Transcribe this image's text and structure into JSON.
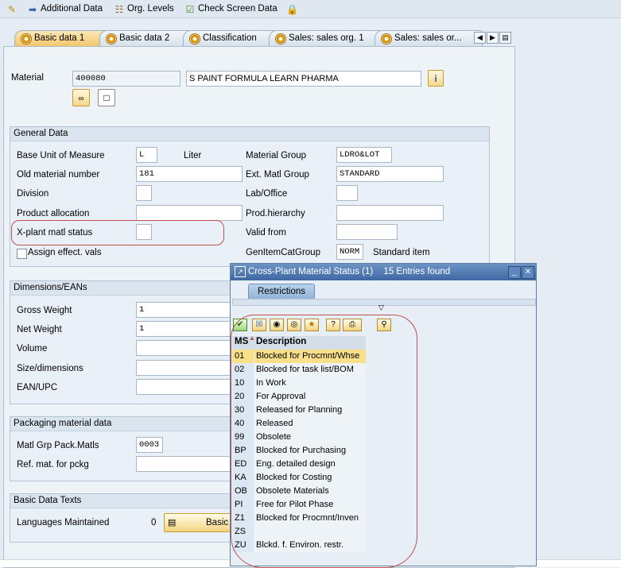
{
  "toolbar": {
    "additional_data": "Additional Data",
    "org_levels": "Org. Levels",
    "check_screen_data": "Check Screen Data"
  },
  "tabs": [
    {
      "label": "Basic data 1"
    },
    {
      "label": "Basic data 2"
    },
    {
      "label": "Classification"
    },
    {
      "label": "Sales: sales org. 1"
    },
    {
      "label": "Sales: sales or..."
    }
  ],
  "material": {
    "label": "Material",
    "number": "400080",
    "description": "S PAINT FORMULA LEARN PHARMA"
  },
  "general_data": {
    "title": "General Data",
    "base_uom_label": "Base Unit of Measure",
    "base_uom_value": "L",
    "base_uom_text": "Liter",
    "old_material_label": "Old material number",
    "old_material_value": "181",
    "division_label": "Division",
    "product_allocation_label": "Product allocation",
    "xplant_status_label": "X-plant matl status",
    "assign_effect_label": "Assign effect. vals",
    "material_group_label": "Material Group",
    "material_group_value": "LDRO&LOT",
    "ext_matl_group_label": "Ext. Matl Group",
    "ext_matl_group_value": "STANDARD",
    "lab_office_label": "Lab/Office",
    "prod_hierarchy_label": "Prod.hierarchy",
    "valid_from_label": "Valid from",
    "gen_item_cat_label": "GenItemCatGroup",
    "gen_item_cat_value": "NORM",
    "gen_item_cat_text": "Standard item"
  },
  "dimensions": {
    "title": "Dimensions/EANs",
    "gross_weight_label": "Gross Weight",
    "gross_weight_value": "1",
    "net_weight_label": "Net Weight",
    "net_weight_value": "1",
    "volume_label": "Volume",
    "size_label": "Size/dimensions",
    "ean_label": "EAN/UPC"
  },
  "packaging": {
    "title": "Packaging material data",
    "matl_grp_label": "Matl Grp Pack.Matls",
    "matl_grp_value": "0003",
    "ref_mat_label": "Ref. mat. for pckg"
  },
  "basic_texts": {
    "title": "Basic Data Texts",
    "languages_label": "Languages Maintained",
    "languages_count": "0",
    "button_label": "Basic"
  },
  "popup": {
    "title": "Cross-Plant Material Status (1)",
    "entries": "15 Entries found",
    "restrictions_tab": "Restrictions",
    "col_ms": "MS",
    "col_description": "Description",
    "rows": [
      {
        "code": "01",
        "desc": "Blocked for Procmnt/Whse"
      },
      {
        "code": "02",
        "desc": "Blocked for task list/BOM"
      },
      {
        "code": "10",
        "desc": "In Work"
      },
      {
        "code": "20",
        "desc": "For Approval"
      },
      {
        "code": "30",
        "desc": "Released for Planning"
      },
      {
        "code": "40",
        "desc": "Released"
      },
      {
        "code": "99",
        "desc": "Obsolete"
      },
      {
        "code": "BP",
        "desc": "Blocked for Purchasing"
      },
      {
        "code": "ED",
        "desc": "Eng. detailed design"
      },
      {
        "code": "KA",
        "desc": "Blocked for Costing"
      },
      {
        "code": "OB",
        "desc": "Obsolete Materials"
      },
      {
        "code": "PI",
        "desc": "Free for Pilot Phase"
      },
      {
        "code": "Z1",
        "desc": "Blocked for Procmnt/Inven"
      },
      {
        "code": "ZS",
        "desc": ""
      },
      {
        "code": "ZU",
        "desc": "Blckd. f. Environ. restr."
      }
    ]
  }
}
